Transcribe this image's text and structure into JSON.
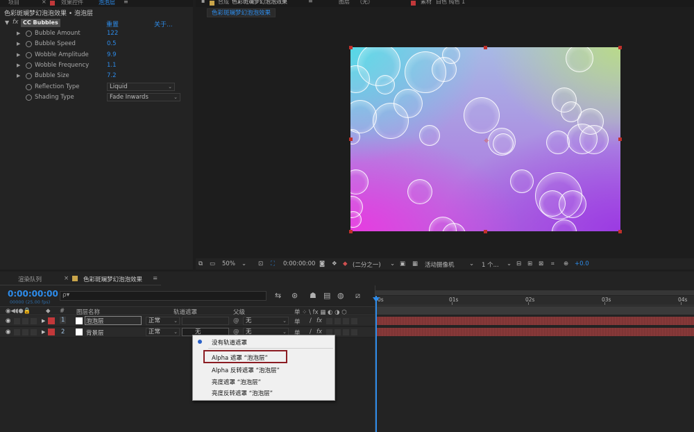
{
  "effect_panel": {
    "tabs": [
      {
        "label": "项目"
      },
      {
        "label": "效果控件",
        "target": "泡泡层"
      }
    ],
    "title": "色彩斑斓梦幻泡泡效果 • 泡泡层",
    "effect": {
      "name": "CC Bubbles",
      "fx": "fx",
      "reset_label": "重置",
      "about_label": "关于..."
    },
    "properties": [
      {
        "label": "Bubble Amount",
        "value": "122"
      },
      {
        "label": "Bubble Speed",
        "value": "0.5"
      },
      {
        "label": "Wobble Amplitude",
        "value": "9.9"
      },
      {
        "label": "Wobble Frequency",
        "value": "1.1"
      },
      {
        "label": "Bubble Size",
        "value": "7.2"
      },
      {
        "label": "Reflection Type",
        "value": "Liquid"
      },
      {
        "label": "Shading Type",
        "value": "Fade Inwards"
      }
    ]
  },
  "comp_panel": {
    "tabs": [
      {
        "label": "合成",
        "target": "色彩斑斓梦幻泡泡效果"
      },
      {
        "label": "图层",
        "target": "（无）"
      },
      {
        "label": "素材",
        "target": "白色 纯色 1"
      }
    ],
    "subtab": "色彩斑斓梦幻泡泡效果",
    "viewer_bar": {
      "zoom": "50%",
      "timecode": "0:00:00:00",
      "resolution": "(二分之一)",
      "camera": "活动摄像机",
      "views": "1 个...",
      "exposure": "+0.0"
    },
    "colors": {
      "handle": "#c0302b",
      "accent": "#2d8ceb"
    }
  },
  "timeline": {
    "tabs": [
      {
        "label": "渲染队列"
      },
      {
        "label": "色彩斑斓梦幻泡泡效果"
      }
    ],
    "timecode": "0:00:00:00",
    "timecode_sub": "00000 (25.00 fps)",
    "search_placeholder": "ρ▾",
    "columns": {
      "num": "#",
      "layer_name": "图层名称",
      "track_matte": "轨道遮罩",
      "parent": "父级",
      "switches": "单 ⁘ \\ fx ▦ ◐ ◑ ⬡"
    },
    "layers": [
      {
        "num": "1",
        "name": "泡泡层",
        "mode": "正常",
        "matte": "",
        "parent": "无"
      },
      {
        "num": "2",
        "name": "背景层",
        "mode": "正常",
        "matte": "无",
        "parent": "无"
      }
    ],
    "ruler": [
      "0s",
      "01s",
      "02s",
      "03s",
      "04s"
    ],
    "context_menu": {
      "items": [
        {
          "label": "没有轨道遮罩",
          "selected": true
        },
        {
          "label": "Alpha 遮罩 “泡泡层”",
          "highlighted": true
        },
        {
          "label": "Alpha 反转遮罩 “泡泡层”"
        },
        {
          "label": "亮度遮罩 “泡泡层”"
        },
        {
          "label": "亮度反转遮罩 “泡泡层”"
        }
      ]
    }
  }
}
